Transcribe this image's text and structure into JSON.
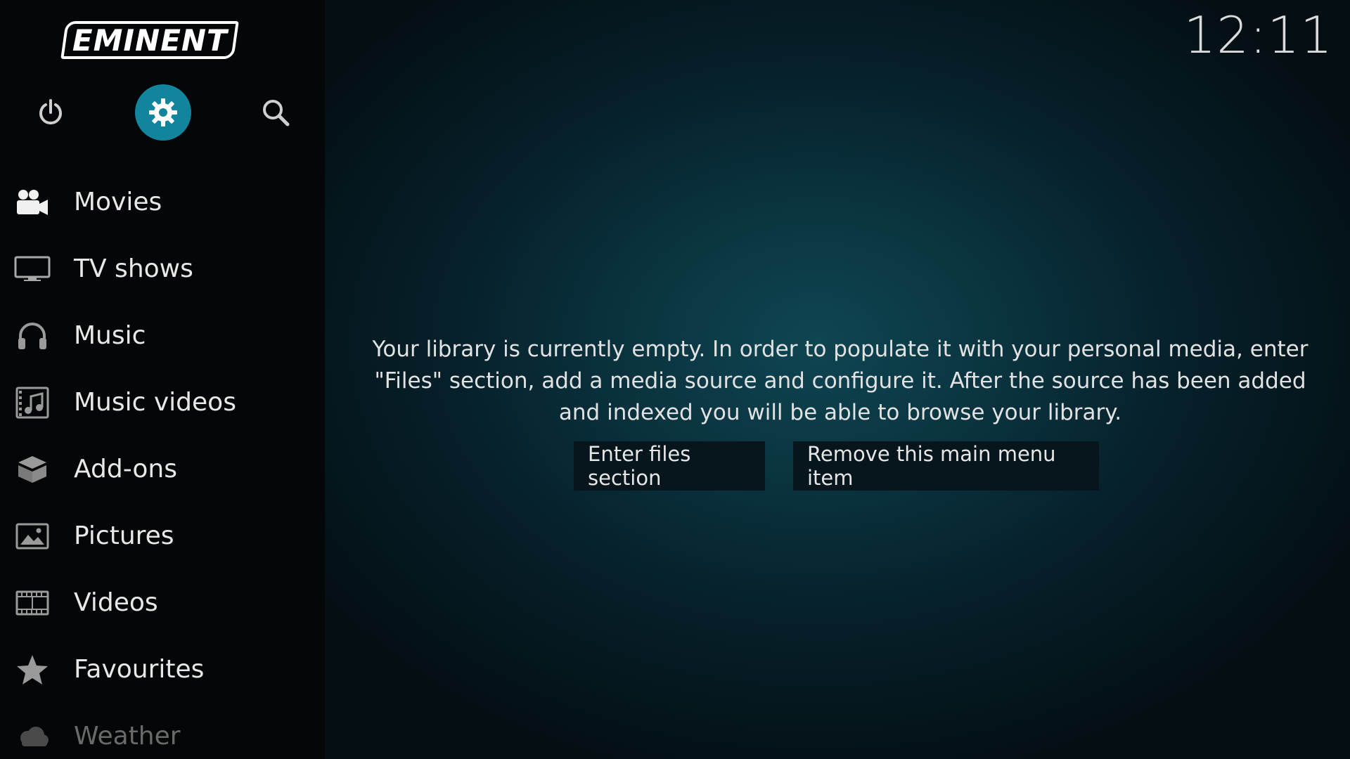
{
  "brand": {
    "logo_text": "EMINENT"
  },
  "clock": {
    "time": "12:11"
  },
  "top_buttons": [
    {
      "id": "power",
      "icon": "power-icon"
    },
    {
      "id": "settings",
      "icon": "gear-icon",
      "active": true
    },
    {
      "id": "search",
      "icon": "search-icon"
    }
  ],
  "menu": {
    "items": [
      {
        "label": "Movies",
        "icon": "movie-camera-icon"
      },
      {
        "label": "TV shows",
        "icon": "tv-icon"
      },
      {
        "label": "Music",
        "icon": "headphones-icon"
      },
      {
        "label": "Music videos",
        "icon": "music-video-icon"
      },
      {
        "label": "Add-ons",
        "icon": "addons-box-icon"
      },
      {
        "label": "Pictures",
        "icon": "picture-icon"
      },
      {
        "label": "Videos",
        "icon": "film-strip-icon"
      },
      {
        "label": "Favourites",
        "icon": "star-icon"
      },
      {
        "label": "Weather",
        "icon": "weather-cloud-icon"
      }
    ]
  },
  "main": {
    "message": "Your library is currently empty. In order to populate it with your personal media, enter \"Files\" section, add a media source and configure it. After the source has been added and indexed you will be able to browse your library.",
    "buttons": {
      "enter_files": "Enter files section",
      "remove_item": "Remove this main menu item"
    }
  },
  "colors": {
    "accent": "#12859d",
    "sidebar_bg": "#040607",
    "button_bg": "#07161c",
    "text": "#e6e6e6"
  }
}
